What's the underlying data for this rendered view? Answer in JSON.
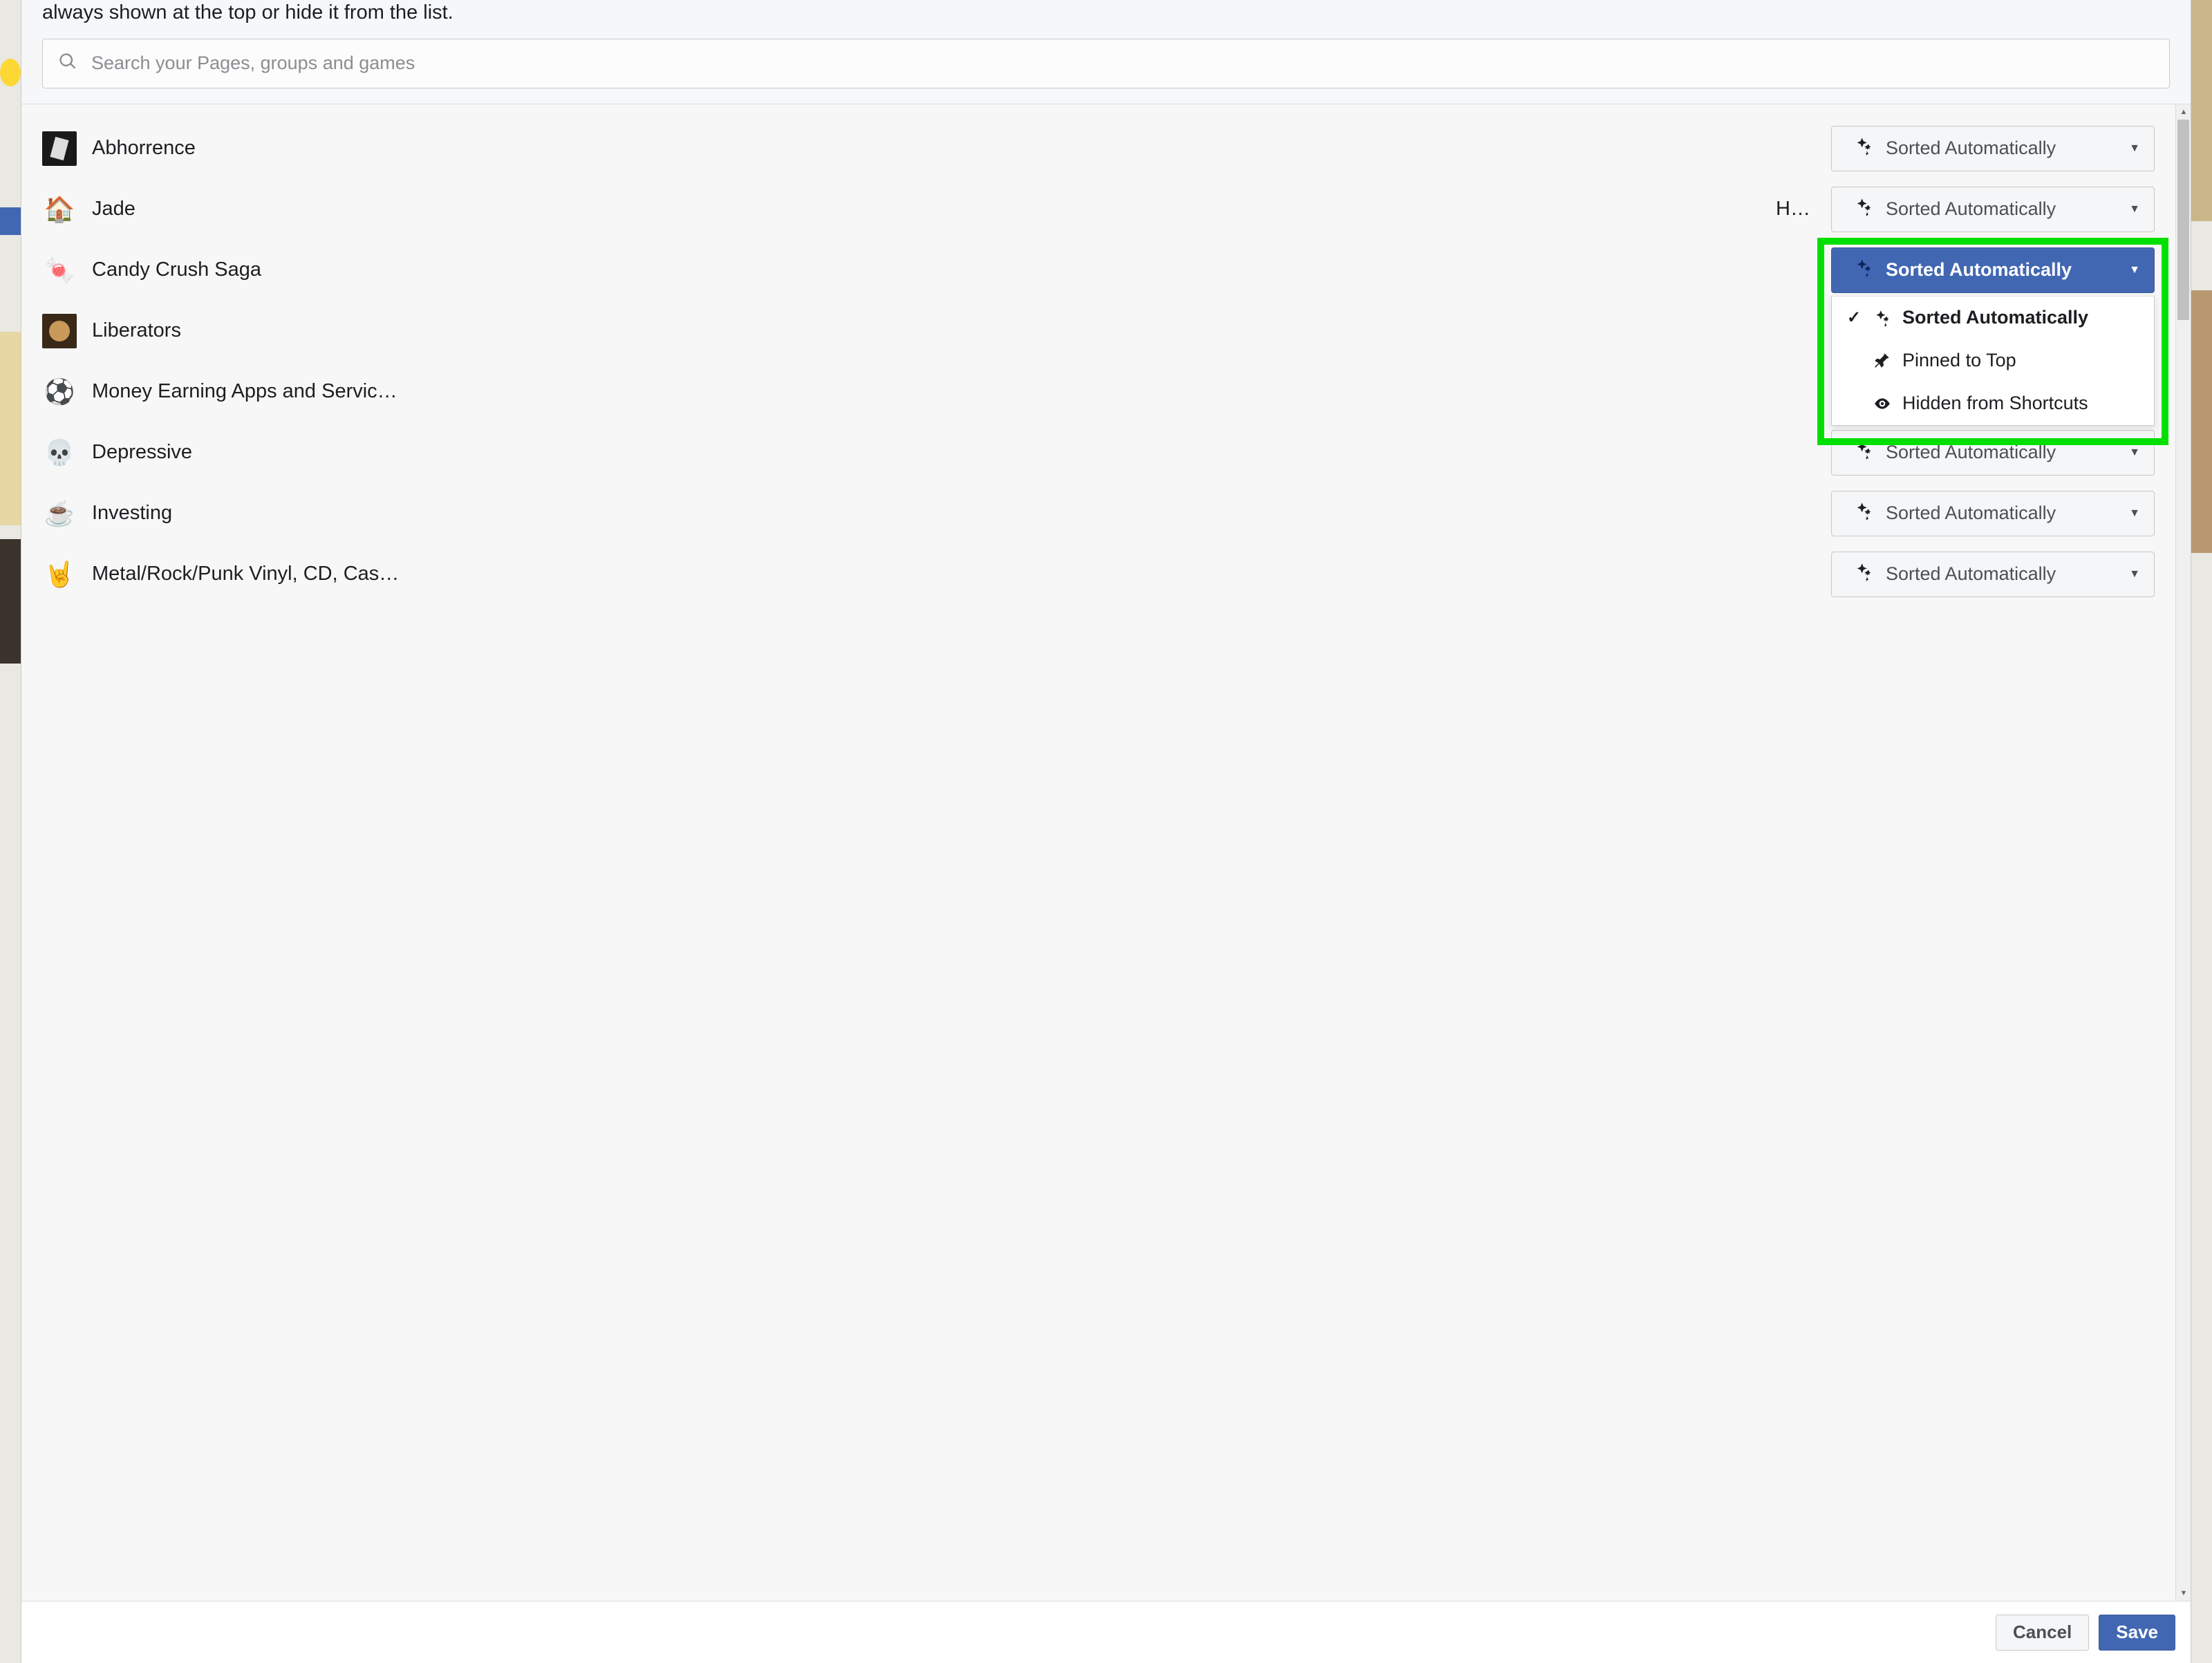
{
  "header": {
    "description_fragment": "always shown at the top or hide it from the list.",
    "search_placeholder": "Search your Pages, groups and games"
  },
  "sort_label": "Sorted Automatically",
  "items": [
    {
      "name": "Abhorrence",
      "avatar": "dark",
      "extra": ""
    },
    {
      "name": "Jade",
      "avatar": "🏠",
      "extra": "H…"
    },
    {
      "name": "Candy Crush Saga",
      "avatar": "🍬",
      "extra": "",
      "open": true
    },
    {
      "name": "Liberators",
      "avatar": "dark2",
      "extra": ""
    },
    {
      "name": "Money Earning Apps and Servic…",
      "avatar": "⚽",
      "extra": ""
    },
    {
      "name": "Depressive",
      "avatar": "💀",
      "extra": ""
    },
    {
      "name": "Investing",
      "avatar": "☕",
      "extra": ""
    },
    {
      "name": "Metal/Rock/Punk Vinyl, CD, Cas…",
      "avatar": "🤘",
      "extra": ""
    }
  ],
  "dropdown": {
    "options": [
      {
        "label": "Sorted Automatically",
        "icon": "sparkle",
        "selected": true
      },
      {
        "label": "Pinned to Top",
        "icon": "pin",
        "selected": false
      },
      {
        "label": "Hidden from Shortcuts",
        "icon": "eye",
        "selected": false
      }
    ]
  },
  "footer": {
    "cancel": "Cancel",
    "save": "Save"
  }
}
